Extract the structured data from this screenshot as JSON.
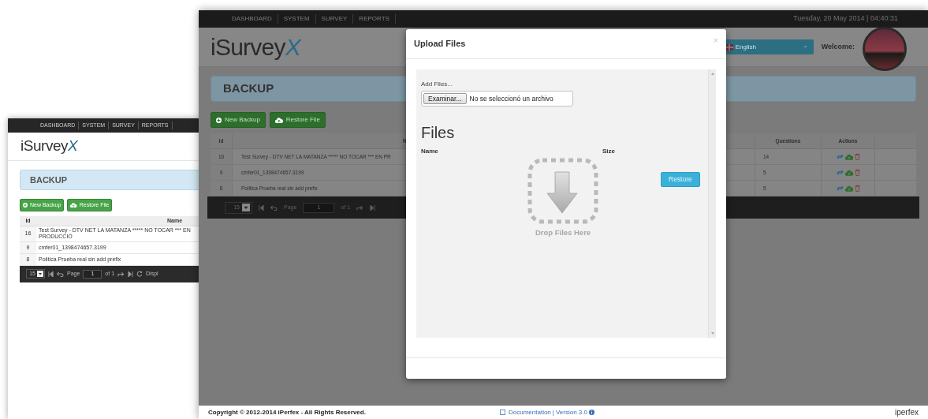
{
  "back_window": {
    "nav": [
      "DASHBOARD",
      "SYSTEM",
      "SURVEY",
      "REPORTS"
    ],
    "logo": {
      "text": "iSurvey",
      "mark": "X"
    },
    "page_title": "BACKUP",
    "buttons": [
      "New Backup",
      "Restore File"
    ],
    "table": {
      "columns": [
        "Id",
        "Name"
      ],
      "rows": [
        {
          "id": "16",
          "name": "Test Survey - DTV NET LA MATANZA ***** NO TOCAR *** EN PRODUCCIO"
        },
        {
          "id": "9",
          "name": "cmfer01_1398474657.3199"
        },
        {
          "id": "8",
          "name": "Politica Prueba real sin add prefix"
        }
      ]
    },
    "pager": {
      "page_size": "15",
      "page_label": "Page",
      "page": "1",
      "of": "of 1",
      "display": "Displ"
    }
  },
  "front_window": {
    "nav": [
      "DASHBOARD",
      "SYSTEM",
      "SURVEY",
      "REPORTS"
    ],
    "datetime": "Tuesday, 20 May 2014 | 04:40:31",
    "logo": {
      "text": "iSurvey",
      "mark": "X"
    },
    "language": "English",
    "welcome": "Welcome:",
    "page_title": "BACKUP",
    "buttons": [
      "New Backup",
      "Restore File"
    ],
    "table": {
      "columns": [
        "Id",
        "N",
        "Questions",
        "Actions"
      ],
      "rows": [
        {
          "id": "16",
          "name": "Test Survey - DTV NET LA MATANZA ***** NO TOCAR *** EN PR",
          "questions": "14"
        },
        {
          "id": "9",
          "name": "cmfer01_1398474657.3199",
          "questions": "5"
        },
        {
          "id": "8",
          "name": "Politica Prueba real sin add prefix",
          "questions": "5"
        }
      ]
    },
    "pager": {
      "page_size": "15",
      "page_label": "Page",
      "page": "1",
      "of": "of 1"
    },
    "modal": {
      "title": "Upload Files",
      "close": "×",
      "add_files_label": "Add Files...",
      "browse_button": "Examinar...",
      "file_status": "No se seleccionó un archivo",
      "files_heading": "Files",
      "columns": [
        "Name",
        "Size"
      ],
      "restore_button": "Restore",
      "drop_text": "Drop Files Here"
    },
    "footer": {
      "copyright": "Copyright © 2012-2014 iPerfex - All Rights Reserved.",
      "documentation": "Documentation",
      "separator": "|",
      "version": "Version 3.0",
      "brand": "iperfex"
    }
  }
}
